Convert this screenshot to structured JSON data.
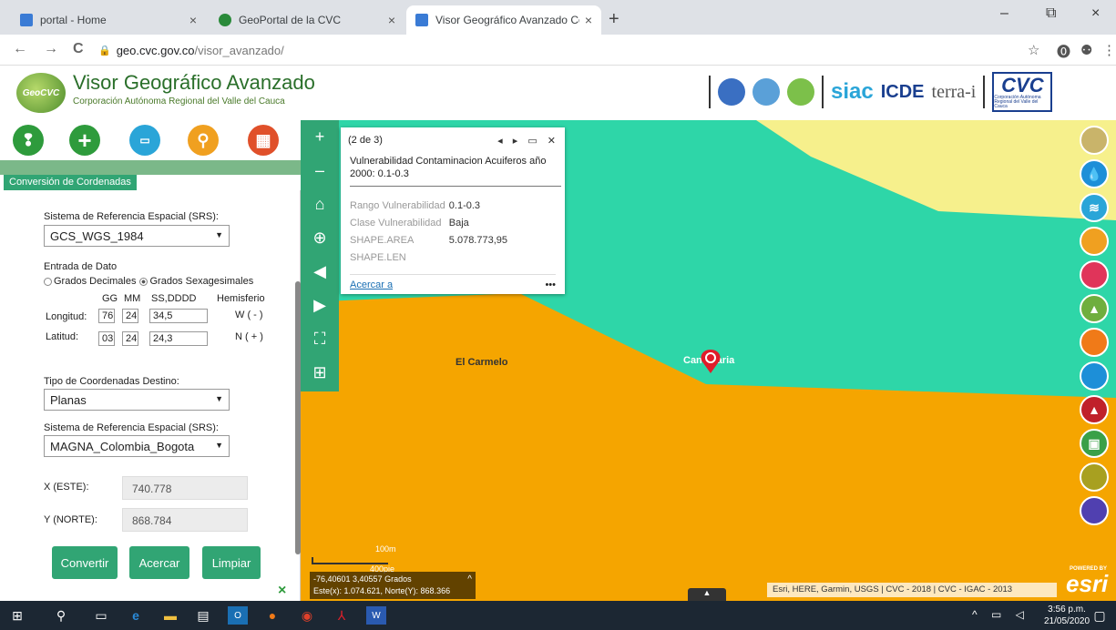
{
  "browser": {
    "tabs": [
      {
        "title": "portal - Home",
        "close": "×"
      },
      {
        "title": "GeoPortal de la CVC",
        "close": "×"
      },
      {
        "title": "Visor Geográfico Avanzado Corpo",
        "close": "×"
      }
    ],
    "new_tab": "+",
    "url_host": "geo.cvc.gov.co",
    "url_path": "/visor_avanzado/",
    "window_controls": {
      "minimize": "–",
      "maximize": "⧉",
      "close": "×"
    },
    "nav": {
      "back": "←",
      "forward": "→",
      "reload": "C"
    },
    "toolbar_icons": {
      "star": "☆",
      "extension": "⓿",
      "profile": "⚉",
      "menu": "⋮"
    }
  },
  "header": {
    "logo_text": "GeoCVC",
    "title": "Visor Geográfico Avanzado",
    "subtitle": "Corporación Autónoma Regional del Valle del Cauca",
    "partner_siac": "siac",
    "partner_icde": "ICDE",
    "partner_terra": "terra-i",
    "cvc_logo": "CVC",
    "cvc_logo_sub": "Corporación Autónoma Regional del Valle del Cauca"
  },
  "panel": {
    "tab_label": "Conversión de Cordenadas",
    "srs_label": "Sistema de Referencia Espacial (SRS):",
    "srs_value": "GCS_WGS_1984",
    "entrada_label": "Entrada de Dato",
    "radio_decimal": "Grados Decimales",
    "radio_sexagesimal": "Grados Sexagesimales",
    "col_gg": "GG",
    "col_mm": "MM",
    "col_ss": "SS,DDDD",
    "col_hem": "Hemisferio",
    "longitud_label": "Longitud:",
    "longitud": {
      "gg": "76",
      "mm": "24",
      "ss": "34,5",
      "hem": "W ( - )"
    },
    "latitud_label": "Latitud:",
    "latitud": {
      "gg": "03",
      "mm": "24",
      "ss": "24,3",
      "hem": "N ( + )"
    },
    "tipo_destino_label": "Tipo de Coordenadas Destino:",
    "tipo_destino_value": "Planas",
    "srs2_label": "Sistema de Referencia Espacial (SRS):",
    "srs2_value": "MAGNA_Colombia_Bogota",
    "x_label": "X (ESTE):",
    "x_value": "740.778",
    "y_label": "Y (NORTE):",
    "y_value": "868.784",
    "btn_convertir": "Convertir",
    "btn_acercar": "Acercar",
    "btn_limpiar": "Limpiar",
    "close": "×"
  },
  "popup": {
    "counter": "(2 de 3)",
    "controls": "◂ ▸ ▭ ✕",
    "title": "Vulnerabilidad Contaminacion Acuiferos año 2000: 0.1-0.3",
    "rows": [
      {
        "k": "Rango Vulnerabilidad",
        "v": "0.1-0.3"
      },
      {
        "k": "Clase Vulnerabilidad",
        "v": "Baja"
      },
      {
        "k": "SHAPE.AREA",
        "v": "5.078.773,95"
      },
      {
        "k": "SHAPE.LEN",
        "v": ""
      }
    ],
    "zoom_link": "Acercar a",
    "more": "•••"
  },
  "map": {
    "label_carmelo": "El Carmelo",
    "label_candelaria": "Candelaria",
    "scale_top": "100m",
    "scale_bottom": "400pie",
    "coords_line1": "-76,40601 3,40557 Grados",
    "coords_line2": "Este(x): 1.074.621, Norte(Y): 868.366",
    "coords_toggle": "^",
    "attribution": "Esri, HERE, Garmin, USGS | CVC - 2018 | CVC - IGAC - 2013",
    "esri": "esri",
    "esri_powered": "POWERED BY",
    "zoom_in": "+",
    "zoom_out": "–",
    "expand_arrow": "▲"
  },
  "tool_icons": [
    "pin-icon",
    "add-icon",
    "ruler-icon",
    "location-icon",
    "calculator-icon"
  ],
  "right_icons": [
    "#c9b46a",
    "#1d8fd8",
    "#2aa5d8",
    "#f0a020",
    "#e0345a",
    "#6fae3e",
    "#f07a18",
    "#1d8fd8",
    "#c0202a",
    "#3aa048",
    "#a8a020",
    "#5040b0"
  ],
  "colors": {
    "green_accent": "#31a574",
    "map_orange": "#f5a500",
    "map_teal": "#2ed6a8",
    "map_yellow": "#f6f08c"
  },
  "taskbar": {
    "time": "3:56 p.m.",
    "date": "21/05/2020"
  }
}
